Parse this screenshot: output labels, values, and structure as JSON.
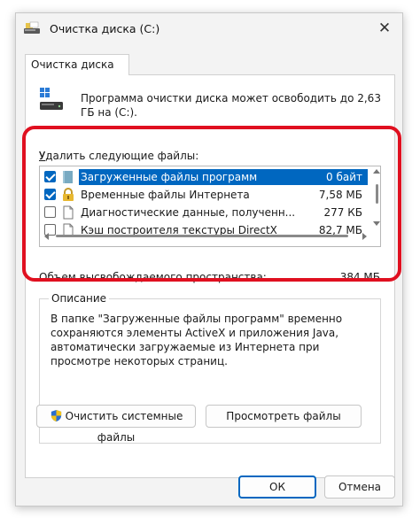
{
  "window": {
    "title": "Очистка диска  (C:)",
    "close_glyph": "✕"
  },
  "tab": {
    "label": "Очистка диска"
  },
  "intro": {
    "text": "Программа очистки диска может освободить до 2,63 ГБ на  (C:)."
  },
  "files": {
    "label": "Удалить следующие файлы:",
    "rows": [
      {
        "name": "Загруженные файлы программ",
        "size": "0 байт",
        "checked": true,
        "selected": true,
        "icon": "folder-icon"
      },
      {
        "name": "Временные файлы Интернета",
        "size": "7,58 МБ",
        "checked": true,
        "selected": false,
        "icon": "lock-icon"
      },
      {
        "name": "Диагностические данные, полученн...",
        "size": "277 КБ",
        "checked": false,
        "selected": false,
        "icon": "file-icon"
      },
      {
        "name": "Кэш построителя текстуры DirectX",
        "size": "82,7 МБ",
        "checked": false,
        "selected": false,
        "icon": "file-icon"
      }
    ]
  },
  "space": {
    "label": "Объем высвобождаемого пространства:",
    "value": "384 МБ"
  },
  "description": {
    "legend": "Описание",
    "text": "В папке \"Загруженные файлы программ\" временно сохраняются элементы ActiveX и приложения Java, автоматически загружаемые из Интернета при просмотре некоторых страниц."
  },
  "buttons": {
    "clean_system": "Очистить системные файлы",
    "view_files": "Просмотреть файлы",
    "ok": "ОК",
    "cancel": "Отмена"
  },
  "colors": {
    "accent": "#0067c0",
    "highlight": "#e01020"
  }
}
